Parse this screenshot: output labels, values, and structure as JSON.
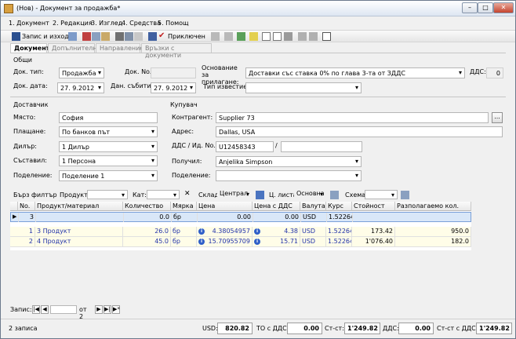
{
  "window": {
    "title": "(Нов) - Документ за продажба*",
    "btn_min": "–",
    "btn_max": "□",
    "btn_close": "✕"
  },
  "menu": [
    "1. Документ",
    "2. Редакция",
    "3. Изглед",
    "4. Средства",
    "5. Помощ"
  ],
  "toolbar": {
    "save_close": "Запис и изход",
    "post": "Приключен"
  },
  "tabs": [
    "Документ",
    "Допълнителни",
    "Направление",
    "Връзки с документи"
  ],
  "general": {
    "title": "Общи",
    "doc_type_label": "Док. тип:",
    "doc_type_value": "Продажба",
    "doc_no_label": "Док. No.",
    "doc_no_value": "",
    "basis_label": "Основание за прилагане:",
    "basis_value": "Доставки със ставка 0% по глава 3-та от ЗДДС",
    "vat_label": "ДДС:",
    "vat_value": "0",
    "doc_date_label": "Док. дата:",
    "doc_date_value": "27. 9.2012",
    "tax_event_label": "Дан. събитие:",
    "tax_event_value": "27. 9.2012",
    "notice_label": "Тип известие:",
    "notice_value": ""
  },
  "supplier": {
    "title": "Доставчик",
    "place_label": "Място:",
    "place_value": "София",
    "payment_label": "Плащане:",
    "payment_value": "По банков път",
    "dealer_label": "Дилър:",
    "dealer_value": "1 Дилър",
    "author_label": "Съставил:",
    "author_value": "1 Персона",
    "division_label": "Поделение:",
    "division_value": "Поделение 1"
  },
  "buyer": {
    "title": "Купувач",
    "contragent_label": "Контрагент:",
    "contragent_value": "Supplier 73",
    "browse": "...",
    "address_label": "Адрес:",
    "address_value": "Dallas, USA",
    "vat_id_label": "ДДС / Ид. No.",
    "vat_no": "U12458343",
    "slash": "/",
    "id_no": "",
    "receiver_label": "Получил:",
    "receiver_value": "Anjelika Simpson",
    "division_label": "Поделение:",
    "division_value": ""
  },
  "filter": {
    "quick": "Бърз филтър",
    "product_label": "Продукт:",
    "cat_label": "Кат:",
    "warehouse_label": "Склад",
    "warehouse_value": "Централ",
    "pricelist_label": "Ц. листа",
    "pricelist_value": "Основна",
    "scheme_label": "Схема"
  },
  "grid": {
    "columns": [
      "No.",
      "Продукт/материал",
      "Количество",
      "Мярка",
      "Цена",
      "Цена с ДДС",
      "Валута",
      "Курс",
      "Стойност",
      "Разполагаемо кол."
    ],
    "new_row": {
      "no": "3",
      "qty": "0.0",
      "unit": "бр",
      "price": "0.00",
      "price_vat": "0.00",
      "currency": "USD",
      "rate": "1.52264"
    },
    "rows": [
      {
        "no": "1",
        "product": "3 Продукт",
        "qty": "26.0",
        "unit": "бр",
        "price": "4.38054957",
        "price_vat": "4.38",
        "currency": "USD",
        "rate": "1.52264",
        "value": "173.42",
        "available": "950.0"
      },
      {
        "no": "2",
        "product": "4 Продукт",
        "qty": "45.0",
        "unit": "бр",
        "price": "15.70955709",
        "price_vat": "15.71",
        "currency": "USD",
        "rate": "1.52264",
        "value": "1'076.40",
        "available": "182.0"
      }
    ]
  },
  "nav": {
    "record_label": "Запис:",
    "current": "",
    "of": "от 2"
  },
  "status": {
    "count": "2 записа",
    "usd_label": "USD:",
    "usd_value": "820.82",
    "to_vat_label": "ТО с ДДС:",
    "to_vat_value": "0.00",
    "st_label": "Ст-ст:",
    "st_value": "1'249.82",
    "vat_label": "ДДС:",
    "vat_value": "0.00",
    "st_vat_label": "Ст-ст с ДДС:",
    "st_vat_value": "1'249.82"
  }
}
